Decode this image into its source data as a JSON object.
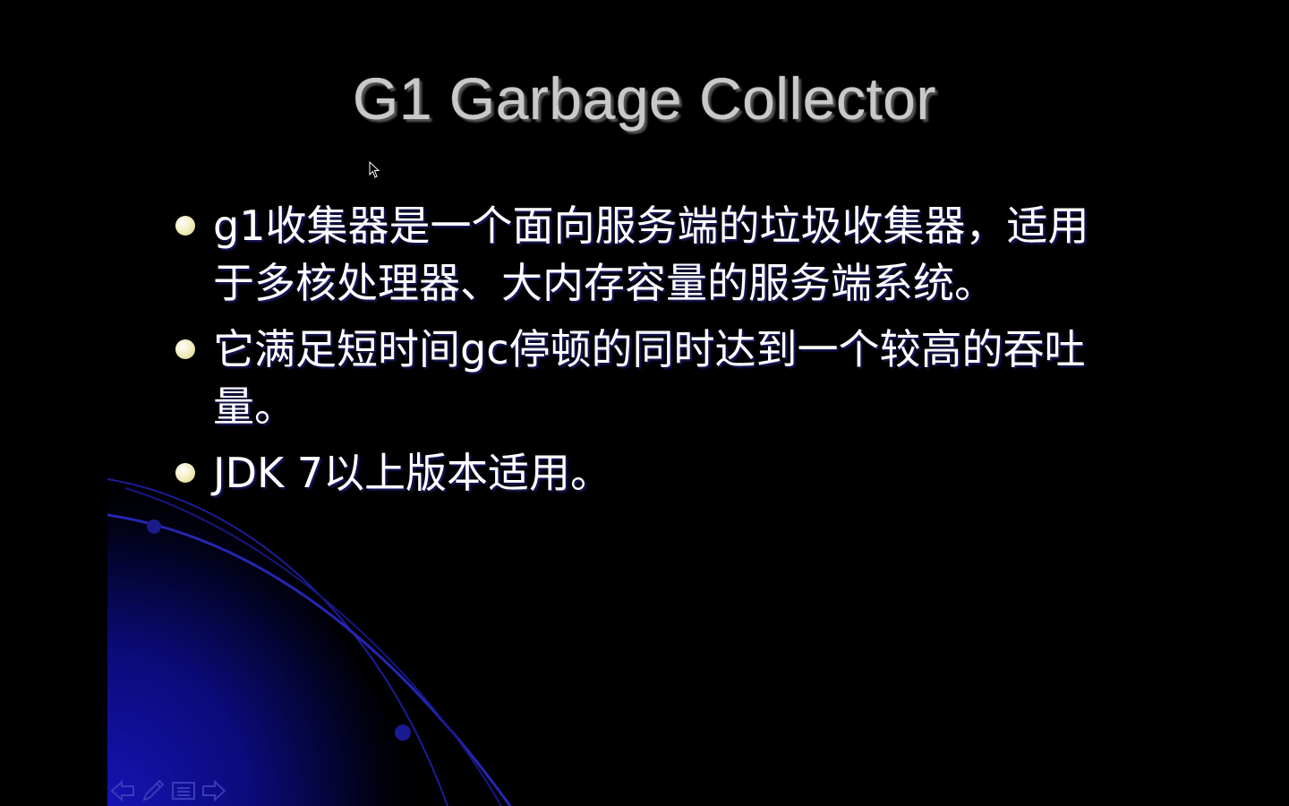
{
  "slide": {
    "title": "G1 Garbage Collector",
    "bullets": [
      "g1收集器是一个面向服务端的垃圾收集器，适用于多核处理器、大内存容量的服务端系统。",
      "它满足短时间gc停顿的同时达到一个较高的吞吐量。",
      "JDK 7以上版本适用。"
    ]
  },
  "navigation": {
    "icons": [
      "previous-arrow-icon",
      "pen-icon",
      "menu-icon",
      "next-arrow-icon"
    ]
  },
  "colors": {
    "background": "#000000",
    "accent_blue": "#1a1aa8",
    "title": "#c9c9c9",
    "text": "#ffffff",
    "bullet": "#f4f0c4"
  }
}
